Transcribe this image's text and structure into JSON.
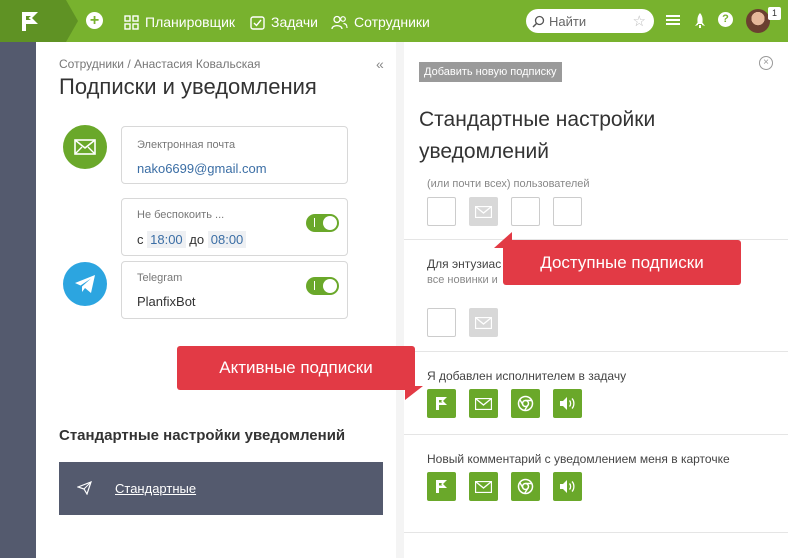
{
  "topbar": {
    "nav": [
      {
        "label": "Планировщик",
        "icon": "grid-icon"
      },
      {
        "label": "Задачи",
        "icon": "checkbox-icon"
      },
      {
        "label": "Сотрудники",
        "icon": "people-icon"
      }
    ],
    "search_placeholder": "Найти",
    "avatar_badge": "1"
  },
  "left": {
    "breadcrumb": "Сотрудники / Анастасия Ковальская",
    "title": "Подписки и уведомления",
    "email": {
      "label": "Электронная почта",
      "value": "nako6699@gmail.com"
    },
    "dnd": {
      "label": "Не беспокоить ...",
      "from_word": "с",
      "from": "18:00",
      "to_word": "до",
      "to": "08:00",
      "enabled": true
    },
    "telegram": {
      "label": "Telegram",
      "value": "PlanfixBot",
      "enabled": true
    },
    "section_title": "Стандартные настройки уведомлений",
    "standard_item": "Стандартные"
  },
  "right": {
    "add_button": "Добавить новую подписку",
    "title": "Стандартные настройки уведомлений",
    "group1_label": "(или почти всех) пользователей",
    "group2_label": "Для энтузиас",
    "group2_sublabel": "все новинки и",
    "group3_label": "Я добавлен исполнителем в задачу",
    "group4_label": "Новый комментарий с уведомлением меня в карточке"
  },
  "callouts": {
    "available": "Доступные подписки",
    "active": "Активные подписки"
  },
  "colors": {
    "brand_green": "#78b22e",
    "dark_green": "#5f9224",
    "sidebar_dark": "#545a6e",
    "callout_red": "#e23a45",
    "telegram_blue": "#2ca5e0"
  }
}
